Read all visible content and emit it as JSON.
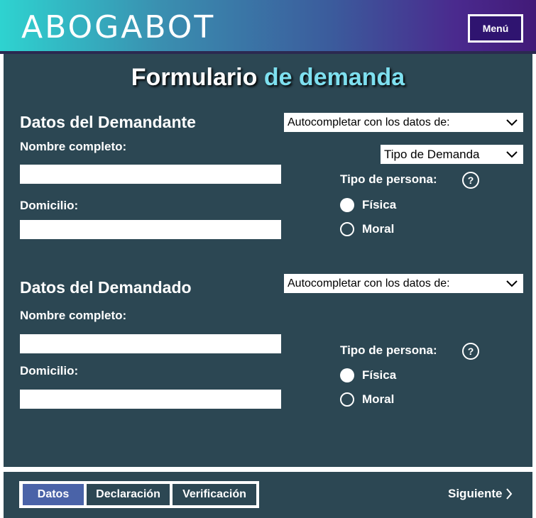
{
  "header": {
    "logo": "ABOGABOT",
    "menu_label": "Menú"
  },
  "page_title": {
    "part1": "Formulario ",
    "part2": "de demanda"
  },
  "demandante": {
    "title": "Datos del Demandante",
    "autocomplete": "Autocompletar con los datos de:",
    "tipo_demanda": "Tipo de Demanda",
    "nombre_label": "Nombre completo:",
    "nombre_value": "",
    "domicilio_label": "Domicilio:",
    "domicilio_value": "",
    "tipo_persona_label": "Tipo de persona:",
    "help": "?",
    "options": [
      "Física",
      "Moral"
    ],
    "selected": "Física"
  },
  "demandado": {
    "title": "Datos del Demandado",
    "autocomplete": "Autocompletar con los datos de:",
    "nombre_label": "Nombre completo:",
    "nombre_value": "",
    "domicilio_label": "Domicilio:",
    "domicilio_value": "",
    "tipo_persona_label": "Tipo de persona:",
    "help": "?",
    "options": [
      "Física",
      "Moral"
    ],
    "selected": "Física"
  },
  "footer": {
    "tabs": [
      "Datos",
      "Declaración",
      "Verificación"
    ],
    "active_tab": "Datos",
    "next_label": "Siguiente"
  },
  "colors": {
    "panel": "#2c4753",
    "accent_title": "#7ee0f0",
    "active_tab": "#4a63a8",
    "menu_bg": "#2f1470"
  }
}
